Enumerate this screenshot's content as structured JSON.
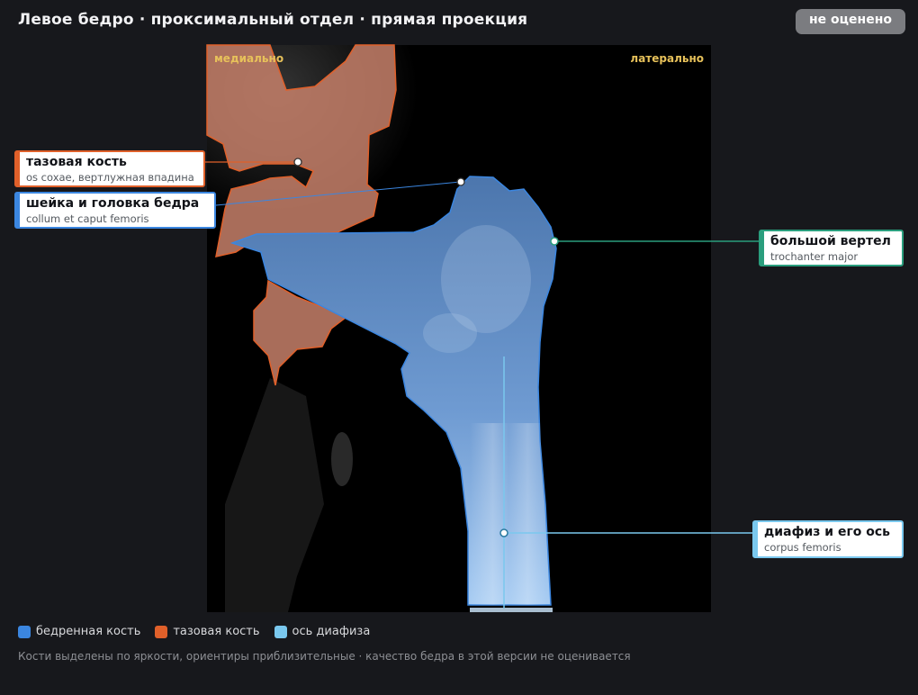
{
  "header": {
    "title": "Левое бедро · проксимальный отдел · прямая проекция",
    "status_badge": "не оценено"
  },
  "viewer": {
    "medial_label": "медиально",
    "lateral_label": "латерально"
  },
  "callouts": {
    "pelvis": {
      "name": "тазовая кость",
      "latin": "os coxae, вертлужная впадина",
      "color": "#e0602a"
    },
    "neck": {
      "name": "шейка и головка бедра",
      "latin": "collum et caput femoris",
      "color": "#3b86e0"
    },
    "trochanter": {
      "name": "большой вертел",
      "latin": "trochanter major",
      "color": "#2a9e7d"
    },
    "shaft": {
      "name": "диафиз и его ось",
      "latin": "corpus femoris",
      "color": "#7ac8ee"
    }
  },
  "legend": {
    "femur": {
      "label": "бедренная кость",
      "color": "#3b86e0"
    },
    "pelvis": {
      "label": "тазовая кость",
      "color": "#e0602a"
    },
    "axis": {
      "label": "ось диафиза",
      "color": "#7ac8ee"
    }
  },
  "footnote": "Кости выделены по яркости, ориентиры приблизительные · качество бедра в этой версии не оценивается"
}
